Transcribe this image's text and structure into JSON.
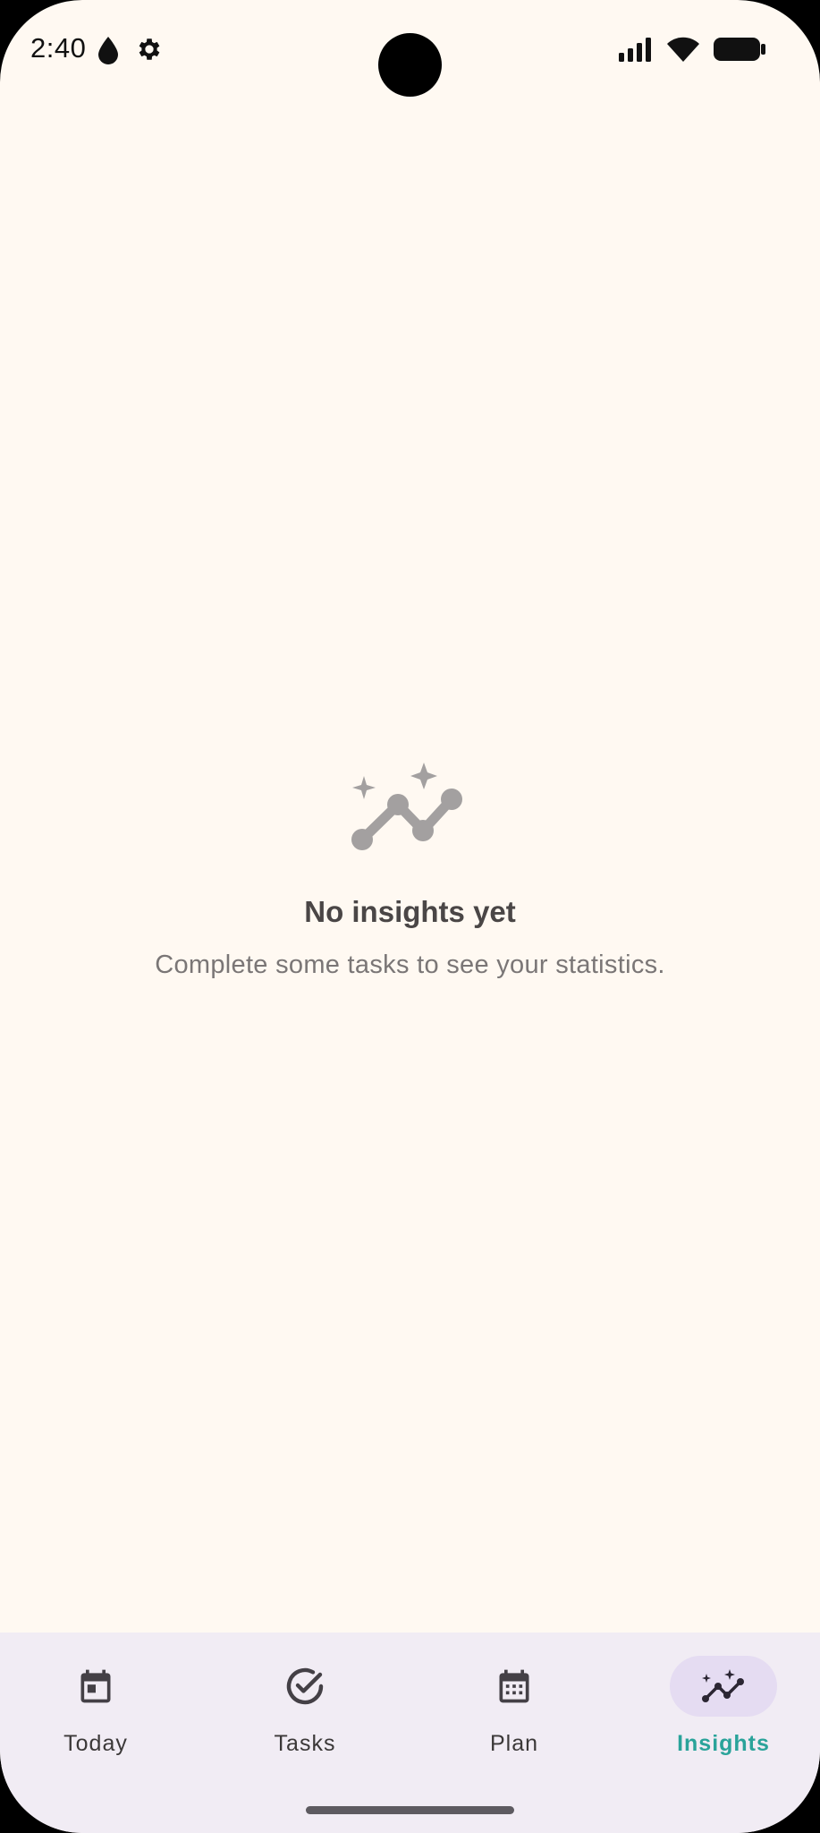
{
  "status_bar": {
    "time": "2:40",
    "icons_left": [
      "water-drop-icon",
      "gear-icon"
    ],
    "icons_right": [
      "signal-icon",
      "wifi-icon",
      "battery-icon"
    ]
  },
  "empty_state": {
    "icon": "insights-sparkle-chart-icon",
    "title": "No insights yet",
    "subtitle": "Complete some tasks to see your statistics."
  },
  "nav": {
    "items": [
      {
        "label": "Today",
        "icon": "calendar-today-icon",
        "active": false
      },
      {
        "label": "Tasks",
        "icon": "check-circle-icon",
        "active": false
      },
      {
        "label": "Plan",
        "icon": "calendar-grid-icon",
        "active": false
      },
      {
        "label": "Insights",
        "icon": "insights-icon",
        "active": true
      }
    ]
  },
  "colors": {
    "background": "#fff9f2",
    "nav_background": "#f1ecf4",
    "active_pill": "#e5dcf2",
    "active_label": "#2aa39a",
    "empty_icon": "#a3a0a0"
  }
}
